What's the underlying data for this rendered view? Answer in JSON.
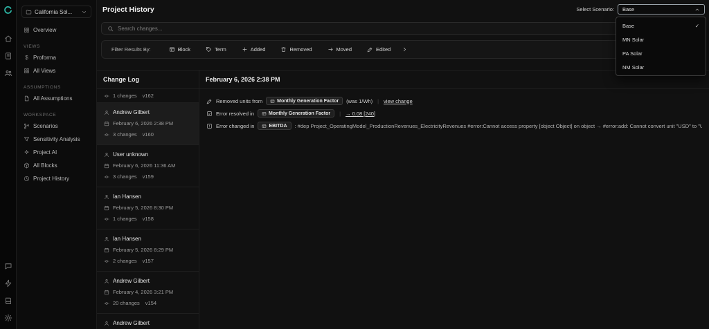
{
  "colors": {
    "accent": "#2fbfae",
    "background": "#111111",
    "panel_border": "#1f1f1f",
    "selected_entry_bg": "#1c1c1c"
  },
  "rail": {
    "icons": [
      "logo",
      "home",
      "notebook",
      "users",
      "chat",
      "zap",
      "book",
      "gear"
    ]
  },
  "sidebar": {
    "project_label": "California Sol...",
    "overview_label": "Overview",
    "sections": [
      {
        "title": "VIEWS",
        "items": [
          {
            "label": "Proforma"
          },
          {
            "label": "All Views"
          }
        ]
      },
      {
        "title": "ASSUMPTIONS",
        "items": [
          {
            "label": "All Assumptions"
          }
        ]
      },
      {
        "title": "WORKSPACE",
        "items": [
          {
            "label": "Scenarios"
          },
          {
            "label": "Sensitivity Analysis"
          },
          {
            "label": "Project AI"
          },
          {
            "label": "All Blocks"
          },
          {
            "label": "Project History"
          }
        ]
      }
    ]
  },
  "header": {
    "title": "Project History",
    "scenario_label": "Select Scenario:",
    "scenario_value": "Base"
  },
  "scenario_dropdown": {
    "options": [
      {
        "label": "Base",
        "selected": true
      },
      {
        "label": "MN Solar",
        "selected": false
      },
      {
        "label": "PA Solar",
        "selected": false
      },
      {
        "label": "NM Solar",
        "selected": false
      }
    ]
  },
  "search": {
    "placeholder": "Search changes..."
  },
  "filters": {
    "label": "Filter Results By:",
    "buttons": [
      {
        "label": "Block",
        "icon": "block-icon"
      },
      {
        "label": "Term",
        "icon": "tag-icon"
      },
      {
        "label": "Added",
        "icon": "plus-icon"
      },
      {
        "label": "Removed",
        "icon": "trash-icon"
      },
      {
        "label": "Moved",
        "icon": "arrow-right-icon"
      },
      {
        "label": "Edited",
        "icon": "pencil-icon"
      }
    ]
  },
  "change_log": {
    "title": "Change Log",
    "partial_top": {
      "changes": "1 changes",
      "version": "v162"
    },
    "entries": [
      {
        "author": "Andrew Gilbert",
        "date": "February 6, 2026 2:38 PM",
        "changes": "3 changes",
        "version": "v160"
      },
      {
        "author": "User unknown",
        "date": "February 6, 2026 11:36 AM",
        "changes": "3 changes",
        "version": "v159"
      },
      {
        "author": "Ian Hansen",
        "date": "February 5, 2026 8:30 PM",
        "changes": "1 changes",
        "version": "v158"
      },
      {
        "author": "Ian Hansen",
        "date": "February 5, 2026 8:29 PM",
        "changes": "2 changes",
        "version": "v157"
      },
      {
        "author": "Andrew Gilbert",
        "date": "February 4, 2026 3:21 PM",
        "changes": "20 changes",
        "version": "v154"
      }
    ],
    "partial_bottom": {
      "author": "Andrew Gilbert"
    }
  },
  "detail": {
    "title": "February 6, 2026 2:38 PM",
    "rows": [
      {
        "action": "Removed units from",
        "chip": "Monthly Generation Factor",
        "suffix": "(was 1/Wh)",
        "link": "view change"
      },
      {
        "action": "Error resolved in",
        "chip": "Monthly Generation Factor",
        "link": "→ 0.08 [240]"
      },
      {
        "action": "Error changed in",
        "chip": "EBITDA",
        "suffix": ": #dep Project_OperatingModel_ProductionRevenues_ElectricityRevenues #error:Cannot access property [object Object] on object → #error:add: Cannot convert unit \"USD\" to \"USD/I"
      }
    ]
  }
}
